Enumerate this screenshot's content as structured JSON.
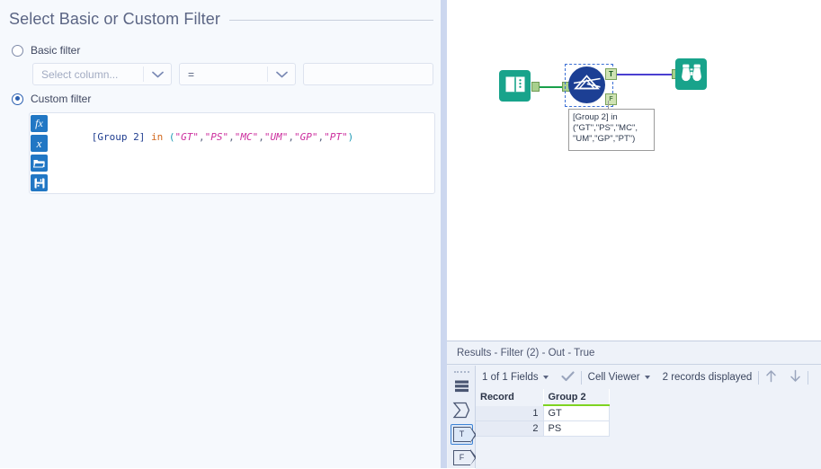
{
  "config": {
    "title": "Select Basic or Custom Filter",
    "basic": {
      "radio_label": "Basic filter",
      "column_placeholder": "Select column...",
      "operator_value": "=",
      "value_input": "",
      "value_placeholder": ""
    },
    "custom": {
      "radio_label": "Custom filter",
      "expression": "[Group 2] in (\"GT\",\"PS\",\"MC\",\"UM\",\"GP\",\"PT\")",
      "tokens": {
        "field": "[Group 2]",
        "keyword": "in",
        "open_paren": "(",
        "close_paren": ")",
        "strings": [
          "\"GT\"",
          "\"PS\"",
          "\"MC\"",
          "\"UM\"",
          "\"GP\"",
          "\"PT\""
        ]
      },
      "toolbar_buttons": [
        {
          "name": "insert-function-button",
          "glyph": "fx"
        },
        {
          "name": "insert-variable-button",
          "glyph": "x"
        },
        {
          "name": "open-expression-button",
          "glyph": "▰"
        },
        {
          "name": "save-expression-button",
          "glyph": "■"
        }
      ]
    }
  },
  "canvas": {
    "tools": [
      {
        "name": "input-data-tool",
        "icon": "book-icon"
      },
      {
        "name": "filter-tool",
        "icon": "prism-icon",
        "selected": true
      },
      {
        "name": "browse-tool",
        "icon": "binoculars-icon"
      }
    ],
    "filter_ports": {
      "true_label": "T",
      "false_label": "F"
    },
    "annotation": "[Group 2] in\n(\"GT\",\"PS\",\"MC\",\n\"UM\",\"GP\",\"PT\")",
    "colors": {
      "tool_teal": "#18a38b",
      "filter_blue": "#1c3f94",
      "selection": "#3b6fd4"
    }
  },
  "results": {
    "title": "Results - Filter (2) - Out - True",
    "rail": [
      {
        "name": "rail-data-button",
        "glyph": "rows"
      },
      {
        "name": "rail-profile-button",
        "glyph": "sigma"
      },
      {
        "name": "rail-true-output-button",
        "glyph": "T",
        "selected": true
      },
      {
        "name": "rail-false-output-button",
        "glyph": "F",
        "selected": false
      }
    ],
    "toolbar": {
      "fields_label": "1 of 1 Fields",
      "check_icon": "checkmark-icon",
      "viewer_label": "Cell Viewer",
      "records_label": "2 records displayed",
      "up_icon": "arrow-up-icon",
      "down_icon": "arrow-down-icon"
    },
    "table": {
      "columns": [
        "Record",
        "Group 2"
      ],
      "rows": [
        {
          "record": "1",
          "group2": "GT"
        },
        {
          "record": "2",
          "group2": "PS"
        }
      ]
    }
  }
}
